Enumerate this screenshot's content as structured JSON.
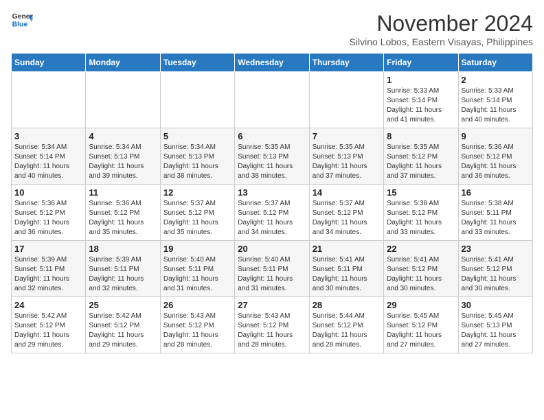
{
  "logo": {
    "line1": "General",
    "line2": "Blue"
  },
  "title": "November 2024",
  "subtitle": "Silvino Lobos, Eastern Visayas, Philippines",
  "weekdays": [
    "Sunday",
    "Monday",
    "Tuesday",
    "Wednesday",
    "Thursday",
    "Friday",
    "Saturday"
  ],
  "weeks": [
    [
      {
        "day": "",
        "info": ""
      },
      {
        "day": "",
        "info": ""
      },
      {
        "day": "",
        "info": ""
      },
      {
        "day": "",
        "info": ""
      },
      {
        "day": "",
        "info": ""
      },
      {
        "day": "1",
        "info": "Sunrise: 5:33 AM\nSunset: 5:14 PM\nDaylight: 11 hours\nand 41 minutes."
      },
      {
        "day": "2",
        "info": "Sunrise: 5:33 AM\nSunset: 5:14 PM\nDaylight: 11 hours\nand 40 minutes."
      }
    ],
    [
      {
        "day": "3",
        "info": "Sunrise: 5:34 AM\nSunset: 5:14 PM\nDaylight: 11 hours\nand 40 minutes."
      },
      {
        "day": "4",
        "info": "Sunrise: 5:34 AM\nSunset: 5:13 PM\nDaylight: 11 hours\nand 39 minutes."
      },
      {
        "day": "5",
        "info": "Sunrise: 5:34 AM\nSunset: 5:13 PM\nDaylight: 11 hours\nand 38 minutes."
      },
      {
        "day": "6",
        "info": "Sunrise: 5:35 AM\nSunset: 5:13 PM\nDaylight: 11 hours\nand 38 minutes."
      },
      {
        "day": "7",
        "info": "Sunrise: 5:35 AM\nSunset: 5:13 PM\nDaylight: 11 hours\nand 37 minutes."
      },
      {
        "day": "8",
        "info": "Sunrise: 5:35 AM\nSunset: 5:12 PM\nDaylight: 11 hours\nand 37 minutes."
      },
      {
        "day": "9",
        "info": "Sunrise: 5:36 AM\nSunset: 5:12 PM\nDaylight: 11 hours\nand 36 minutes."
      }
    ],
    [
      {
        "day": "10",
        "info": "Sunrise: 5:36 AM\nSunset: 5:12 PM\nDaylight: 11 hours\nand 36 minutes."
      },
      {
        "day": "11",
        "info": "Sunrise: 5:36 AM\nSunset: 5:12 PM\nDaylight: 11 hours\nand 35 minutes."
      },
      {
        "day": "12",
        "info": "Sunrise: 5:37 AM\nSunset: 5:12 PM\nDaylight: 11 hours\nand 35 minutes."
      },
      {
        "day": "13",
        "info": "Sunrise: 5:37 AM\nSunset: 5:12 PM\nDaylight: 11 hours\nand 34 minutes."
      },
      {
        "day": "14",
        "info": "Sunrise: 5:37 AM\nSunset: 5:12 PM\nDaylight: 11 hours\nand 34 minutes."
      },
      {
        "day": "15",
        "info": "Sunrise: 5:38 AM\nSunset: 5:12 PM\nDaylight: 11 hours\nand 33 minutes."
      },
      {
        "day": "16",
        "info": "Sunrise: 5:38 AM\nSunset: 5:11 PM\nDaylight: 11 hours\nand 33 minutes."
      }
    ],
    [
      {
        "day": "17",
        "info": "Sunrise: 5:39 AM\nSunset: 5:11 PM\nDaylight: 11 hours\nand 32 minutes."
      },
      {
        "day": "18",
        "info": "Sunrise: 5:39 AM\nSunset: 5:11 PM\nDaylight: 11 hours\nand 32 minutes."
      },
      {
        "day": "19",
        "info": "Sunrise: 5:40 AM\nSunset: 5:11 PM\nDaylight: 11 hours\nand 31 minutes."
      },
      {
        "day": "20",
        "info": "Sunrise: 5:40 AM\nSunset: 5:11 PM\nDaylight: 11 hours\nand 31 minutes."
      },
      {
        "day": "21",
        "info": "Sunrise: 5:41 AM\nSunset: 5:11 PM\nDaylight: 11 hours\nand 30 minutes."
      },
      {
        "day": "22",
        "info": "Sunrise: 5:41 AM\nSunset: 5:12 PM\nDaylight: 11 hours\nand 30 minutes."
      },
      {
        "day": "23",
        "info": "Sunrise: 5:41 AM\nSunset: 5:12 PM\nDaylight: 11 hours\nand 30 minutes."
      }
    ],
    [
      {
        "day": "24",
        "info": "Sunrise: 5:42 AM\nSunset: 5:12 PM\nDaylight: 11 hours\nand 29 minutes."
      },
      {
        "day": "25",
        "info": "Sunrise: 5:42 AM\nSunset: 5:12 PM\nDaylight: 11 hours\nand 29 minutes."
      },
      {
        "day": "26",
        "info": "Sunrise: 5:43 AM\nSunset: 5:12 PM\nDaylight: 11 hours\nand 28 minutes."
      },
      {
        "day": "27",
        "info": "Sunrise: 5:43 AM\nSunset: 5:12 PM\nDaylight: 11 hours\nand 28 minutes."
      },
      {
        "day": "28",
        "info": "Sunrise: 5:44 AM\nSunset: 5:12 PM\nDaylight: 11 hours\nand 28 minutes."
      },
      {
        "day": "29",
        "info": "Sunrise: 5:45 AM\nSunset: 5:12 PM\nDaylight: 11 hours\nand 27 minutes."
      },
      {
        "day": "30",
        "info": "Sunrise: 5:45 AM\nSunset: 5:13 PM\nDaylight: 11 hours\nand 27 minutes."
      }
    ]
  ]
}
